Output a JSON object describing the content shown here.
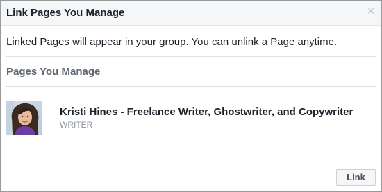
{
  "dialog": {
    "title": "Link Pages You Manage",
    "close_icon": "close-icon",
    "intro_text": "Linked Pages will appear in your group. You can unlink a Page anytime.",
    "section_title": "Pages You Manage",
    "pages": [
      {
        "name": "Kristi Hines - Freelance Writer, Ghostwriter, and Copywriter",
        "role": "WRITER",
        "avatar_icon": "profile-photo"
      }
    ],
    "link_button_label": "Link"
  },
  "colors": {
    "header_bg": "#f5f6f7",
    "text_primary": "#1d2129",
    "text_secondary": "#606770",
    "text_muted": "#90949c",
    "divider": "#dddfe2",
    "button_bg": "#f5f6f7",
    "button_border": "#ced0d4"
  }
}
